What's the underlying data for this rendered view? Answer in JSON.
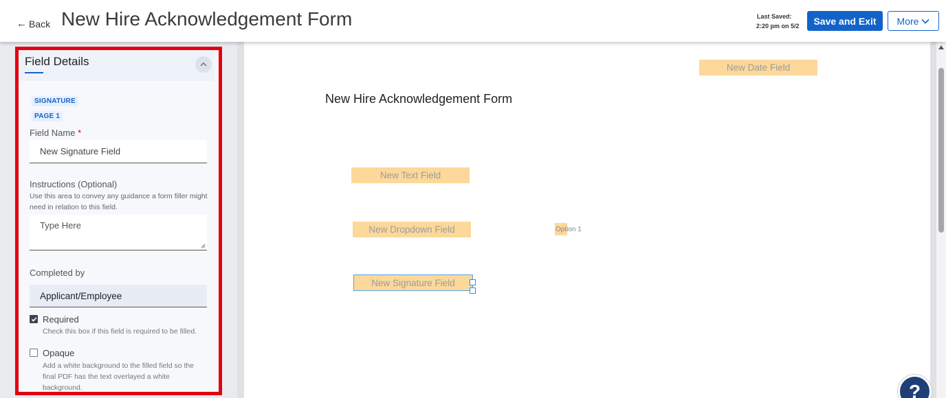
{
  "header": {
    "back_label": "Back",
    "title": "New Hire Acknowledgement Form",
    "last_saved_label": "Last Saved:",
    "last_saved_value": "2:20 pm on 5/2",
    "save_exit_label": "Save and Exit",
    "more_label": "More"
  },
  "panel": {
    "title": "Field Details",
    "type_badge": "SIGNATURE",
    "page_badge": "PAGE 1",
    "field_name_label": "Field Name",
    "field_name_required_mark": "*",
    "field_name_value": "New Signature Field",
    "instructions_label": "Instructions (Optional)",
    "instructions_help": "Use this area to convey any guidance a form filler might need in relation to this field.",
    "instructions_placeholder": "Type Here",
    "completed_by_label": "Completed by",
    "completed_by_value": "Applicant/Employee",
    "required_label": "Required",
    "required_checked": true,
    "required_help": "Check this box if this field is required to be filled.",
    "opaque_label": "Opaque",
    "opaque_checked": false,
    "opaque_help": "Add a white background to the filled field so the final PDF has the text overlayed a white background."
  },
  "document": {
    "title": "New Hire Acknowledgement Form",
    "fields": {
      "date": "New Date Field",
      "text": "New Text Field",
      "dropdown": "New Dropdown Field",
      "dropdown_option": "Option 1",
      "signature": "New Signature Field"
    }
  },
  "help_button_label": "?",
  "colors": {
    "primary": "#1263c9",
    "highlight": "#e2000f",
    "field_fill": "#fcd89a",
    "help_button": "#1e3f78"
  }
}
